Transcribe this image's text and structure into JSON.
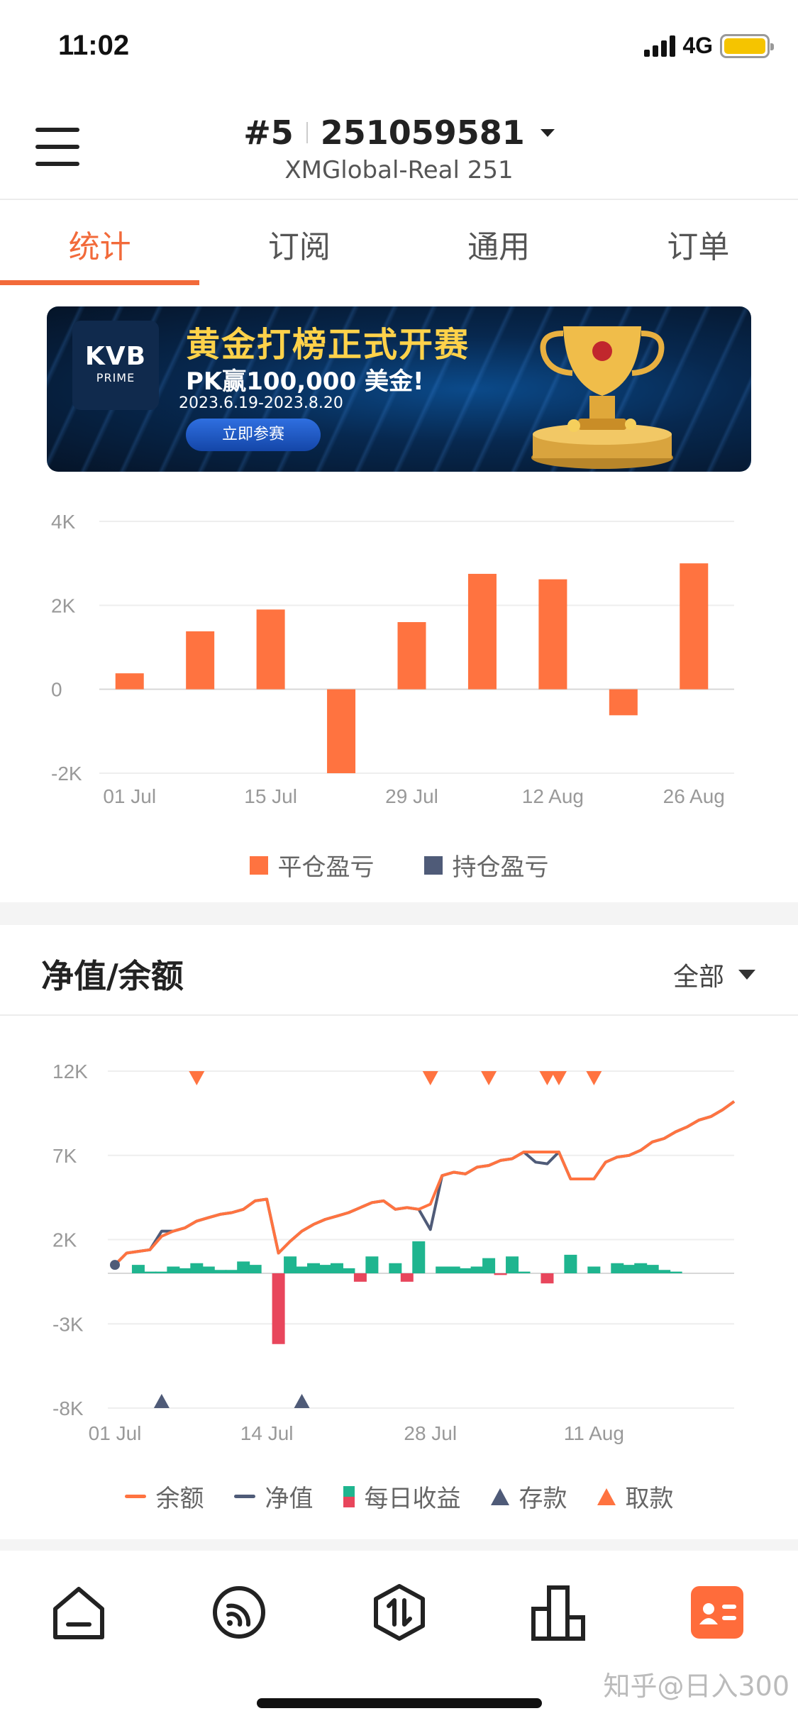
{
  "status_bar": {
    "time": "11:02",
    "network": "4G"
  },
  "header": {
    "account_prefix": "#5",
    "account_number": "251059581",
    "server": "XMGlobal-Real 251"
  },
  "tabs": [
    {
      "label": "统计",
      "active": true
    },
    {
      "label": "订阅",
      "active": false
    },
    {
      "label": "通用",
      "active": false
    },
    {
      "label": "订单",
      "active": false
    }
  ],
  "banner": {
    "logo_main": "KVB",
    "logo_sub": "PRIME",
    "title": "黄金打榜正式开赛",
    "prize": "PK赢100,000 美金!",
    "dates": "2023.6.19-2023.8.20",
    "button": "立即参赛"
  },
  "pnl_chart": {
    "chart_data": {
      "type": "bar",
      "y_ticks": [
        "4K",
        "2K",
        "0",
        "-2K"
      ],
      "ylim": [
        -2000,
        4000
      ],
      "x_tick_labels": [
        "01 Jul",
        "15 Jul",
        "29 Jul",
        "12 Aug",
        "26 Aug"
      ],
      "categories": [
        "01 Jul",
        "08 Jul",
        "15 Jul",
        "22 Jul",
        "29 Jul",
        "05 Aug",
        "12 Aug",
        "19 Aug",
        "26 Aug"
      ],
      "series": [
        {
          "name": "平仓盈亏",
          "color": "#ff7340",
          "values": [
            380,
            1380,
            1900,
            -2000,
            1600,
            2750,
            2620,
            -620,
            3000
          ]
        },
        {
          "name": "持仓盈亏",
          "color": "#4f5b78",
          "values": [
            0,
            0,
            0,
            0,
            0,
            0,
            0,
            0,
            0
          ]
        }
      ]
    }
  },
  "equity_section": {
    "title": "净值/余额",
    "filter": "全部",
    "chart_data": {
      "type": "line",
      "y_ticks": [
        "12K",
        "7K",
        "2K",
        "-3K",
        "-8K"
      ],
      "ylim": [
        -8000,
        12000
      ],
      "x_tick_labels": [
        "01 Jul",
        "14 Jul",
        "28 Jul",
        "11 Aug"
      ],
      "x_days": [
        1,
        14,
        28,
        42
      ],
      "series": [
        {
          "name": "余额",
          "color": "#ff7340",
          "x": [
            1,
            2,
            3,
            4,
            5,
            6,
            7,
            8,
            9,
            10,
            11,
            12,
            13,
            14,
            15,
            16,
            17,
            18,
            19,
            20,
            21,
            22,
            23,
            24,
            25,
            26,
            27,
            28,
            29,
            30,
            31,
            32,
            33,
            34,
            35,
            36,
            37,
            38,
            39,
            40,
            41,
            42,
            43,
            44,
            45,
            46,
            47,
            48,
            49,
            50,
            51,
            52,
            53,
            54
          ],
          "values": [
            500,
            1200,
            1300,
            1400,
            2200,
            2500,
            2700,
            3100,
            3300,
            3500,
            3600,
            3800,
            4300,
            4400,
            1200,
            1900,
            2500,
            2900,
            3200,
            3400,
            3600,
            3900,
            4200,
            4300,
            3800,
            3900,
            3800,
            4100,
            5800,
            6000,
            5900,
            6300,
            6400,
            6700,
            6800,
            7200,
            7200,
            7200,
            7200,
            5600,
            5600,
            5600,
            6600,
            6900,
            7000,
            7300,
            7800,
            8000,
            8400,
            8700,
            9100,
            9300,
            9700,
            10200
          ]
        },
        {
          "name": "净值",
          "color": "#4f5b78",
          "x": [
            1,
            2,
            3,
            4,
            5,
            6,
            7,
            8,
            9,
            10,
            11,
            12,
            13,
            14,
            15,
            16,
            17,
            18,
            19,
            20,
            21,
            22,
            23,
            24,
            25,
            26,
            27,
            28,
            29,
            30,
            31,
            32,
            33,
            34,
            35,
            36,
            37,
            38,
            39,
            40,
            41,
            42,
            43,
            44,
            45,
            46,
            47,
            48,
            49,
            50,
            51,
            52,
            53,
            54
          ],
          "values": [
            500,
            1200,
            1300,
            1400,
            2500,
            2500,
            2700,
            3100,
            3300,
            3500,
            3600,
            3800,
            4300,
            4400,
            1200,
            1900,
            2500,
            2900,
            3200,
            3400,
            3600,
            3900,
            4200,
            4300,
            3800,
            3900,
            3800,
            2600,
            5800,
            6000,
            5900,
            6300,
            6400,
            6700,
            6800,
            7200,
            6600,
            6500,
            7200,
            5600,
            5600,
            5600,
            6600,
            6900,
            7000,
            7300,
            7800,
            8000,
            8400,
            8700,
            9100,
            9300,
            9700,
            10200
          ]
        },
        {
          "name": "每日收益",
          "colors": [
            "#1fb58f",
            "#e8465c"
          ],
          "x": [
            3,
            4,
            5,
            6,
            7,
            8,
            9,
            10,
            11,
            12,
            13,
            15,
            16,
            17,
            18,
            19,
            20,
            21,
            22,
            23,
            25,
            26,
            27,
            29,
            30,
            31,
            32,
            33,
            34,
            35,
            36,
            38,
            40,
            42,
            44,
            45,
            46,
            47,
            48,
            49
          ],
          "values": [
            500,
            100,
            100,
            400,
            300,
            600,
            400,
            200,
            200,
            700,
            500,
            -4200,
            1000,
            400,
            600,
            500,
            600,
            300,
            -500,
            1000,
            600,
            -500,
            1900,
            400,
            400,
            300,
            400,
            900,
            -100,
            1000,
            100,
            -600,
            1100,
            400,
            600,
            500,
            600,
            500,
            200,
            100
          ]
        },
        {
          "name": "存款",
          "color": "#4f5b78",
          "markers_x": [
            5,
            17
          ]
        },
        {
          "name": "取款",
          "color": "#ff7340",
          "markers_x": [
            8,
            28,
            33,
            38,
            39,
            42
          ]
        }
      ]
    }
  },
  "watermark": "知乎@日入300"
}
